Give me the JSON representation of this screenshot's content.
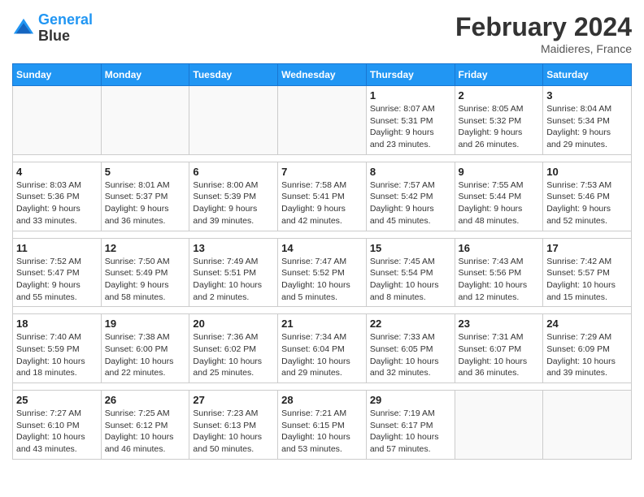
{
  "header": {
    "logo_line1": "General",
    "logo_line2": "Blue",
    "month_year": "February 2024",
    "location": "Maidieres, France"
  },
  "days_of_week": [
    "Sunday",
    "Monday",
    "Tuesday",
    "Wednesday",
    "Thursday",
    "Friday",
    "Saturday"
  ],
  "weeks": [
    [
      {
        "day": "",
        "info": ""
      },
      {
        "day": "",
        "info": ""
      },
      {
        "day": "",
        "info": ""
      },
      {
        "day": "",
        "info": ""
      },
      {
        "day": "1",
        "info": "Sunrise: 8:07 AM\nSunset: 5:31 PM\nDaylight: 9 hours\nand 23 minutes."
      },
      {
        "day": "2",
        "info": "Sunrise: 8:05 AM\nSunset: 5:32 PM\nDaylight: 9 hours\nand 26 minutes."
      },
      {
        "day": "3",
        "info": "Sunrise: 8:04 AM\nSunset: 5:34 PM\nDaylight: 9 hours\nand 29 minutes."
      }
    ],
    [
      {
        "day": "4",
        "info": "Sunrise: 8:03 AM\nSunset: 5:36 PM\nDaylight: 9 hours\nand 33 minutes."
      },
      {
        "day": "5",
        "info": "Sunrise: 8:01 AM\nSunset: 5:37 PM\nDaylight: 9 hours\nand 36 minutes."
      },
      {
        "day": "6",
        "info": "Sunrise: 8:00 AM\nSunset: 5:39 PM\nDaylight: 9 hours\nand 39 minutes."
      },
      {
        "day": "7",
        "info": "Sunrise: 7:58 AM\nSunset: 5:41 PM\nDaylight: 9 hours\nand 42 minutes."
      },
      {
        "day": "8",
        "info": "Sunrise: 7:57 AM\nSunset: 5:42 PM\nDaylight: 9 hours\nand 45 minutes."
      },
      {
        "day": "9",
        "info": "Sunrise: 7:55 AM\nSunset: 5:44 PM\nDaylight: 9 hours\nand 48 minutes."
      },
      {
        "day": "10",
        "info": "Sunrise: 7:53 AM\nSunset: 5:46 PM\nDaylight: 9 hours\nand 52 minutes."
      }
    ],
    [
      {
        "day": "11",
        "info": "Sunrise: 7:52 AM\nSunset: 5:47 PM\nDaylight: 9 hours\nand 55 minutes."
      },
      {
        "day": "12",
        "info": "Sunrise: 7:50 AM\nSunset: 5:49 PM\nDaylight: 9 hours\nand 58 minutes."
      },
      {
        "day": "13",
        "info": "Sunrise: 7:49 AM\nSunset: 5:51 PM\nDaylight: 10 hours\nand 2 minutes."
      },
      {
        "day": "14",
        "info": "Sunrise: 7:47 AM\nSunset: 5:52 PM\nDaylight: 10 hours\nand 5 minutes."
      },
      {
        "day": "15",
        "info": "Sunrise: 7:45 AM\nSunset: 5:54 PM\nDaylight: 10 hours\nand 8 minutes."
      },
      {
        "day": "16",
        "info": "Sunrise: 7:43 AM\nSunset: 5:56 PM\nDaylight: 10 hours\nand 12 minutes."
      },
      {
        "day": "17",
        "info": "Sunrise: 7:42 AM\nSunset: 5:57 PM\nDaylight: 10 hours\nand 15 minutes."
      }
    ],
    [
      {
        "day": "18",
        "info": "Sunrise: 7:40 AM\nSunset: 5:59 PM\nDaylight: 10 hours\nand 18 minutes."
      },
      {
        "day": "19",
        "info": "Sunrise: 7:38 AM\nSunset: 6:00 PM\nDaylight: 10 hours\nand 22 minutes."
      },
      {
        "day": "20",
        "info": "Sunrise: 7:36 AM\nSunset: 6:02 PM\nDaylight: 10 hours\nand 25 minutes."
      },
      {
        "day": "21",
        "info": "Sunrise: 7:34 AM\nSunset: 6:04 PM\nDaylight: 10 hours\nand 29 minutes."
      },
      {
        "day": "22",
        "info": "Sunrise: 7:33 AM\nSunset: 6:05 PM\nDaylight: 10 hours\nand 32 minutes."
      },
      {
        "day": "23",
        "info": "Sunrise: 7:31 AM\nSunset: 6:07 PM\nDaylight: 10 hours\nand 36 minutes."
      },
      {
        "day": "24",
        "info": "Sunrise: 7:29 AM\nSunset: 6:09 PM\nDaylight: 10 hours\nand 39 minutes."
      }
    ],
    [
      {
        "day": "25",
        "info": "Sunrise: 7:27 AM\nSunset: 6:10 PM\nDaylight: 10 hours\nand 43 minutes."
      },
      {
        "day": "26",
        "info": "Sunrise: 7:25 AM\nSunset: 6:12 PM\nDaylight: 10 hours\nand 46 minutes."
      },
      {
        "day": "27",
        "info": "Sunrise: 7:23 AM\nSunset: 6:13 PM\nDaylight: 10 hours\nand 50 minutes."
      },
      {
        "day": "28",
        "info": "Sunrise: 7:21 AM\nSunset: 6:15 PM\nDaylight: 10 hours\nand 53 minutes."
      },
      {
        "day": "29",
        "info": "Sunrise: 7:19 AM\nSunset: 6:17 PM\nDaylight: 10 hours\nand 57 minutes."
      },
      {
        "day": "",
        "info": ""
      },
      {
        "day": "",
        "info": ""
      }
    ]
  ]
}
